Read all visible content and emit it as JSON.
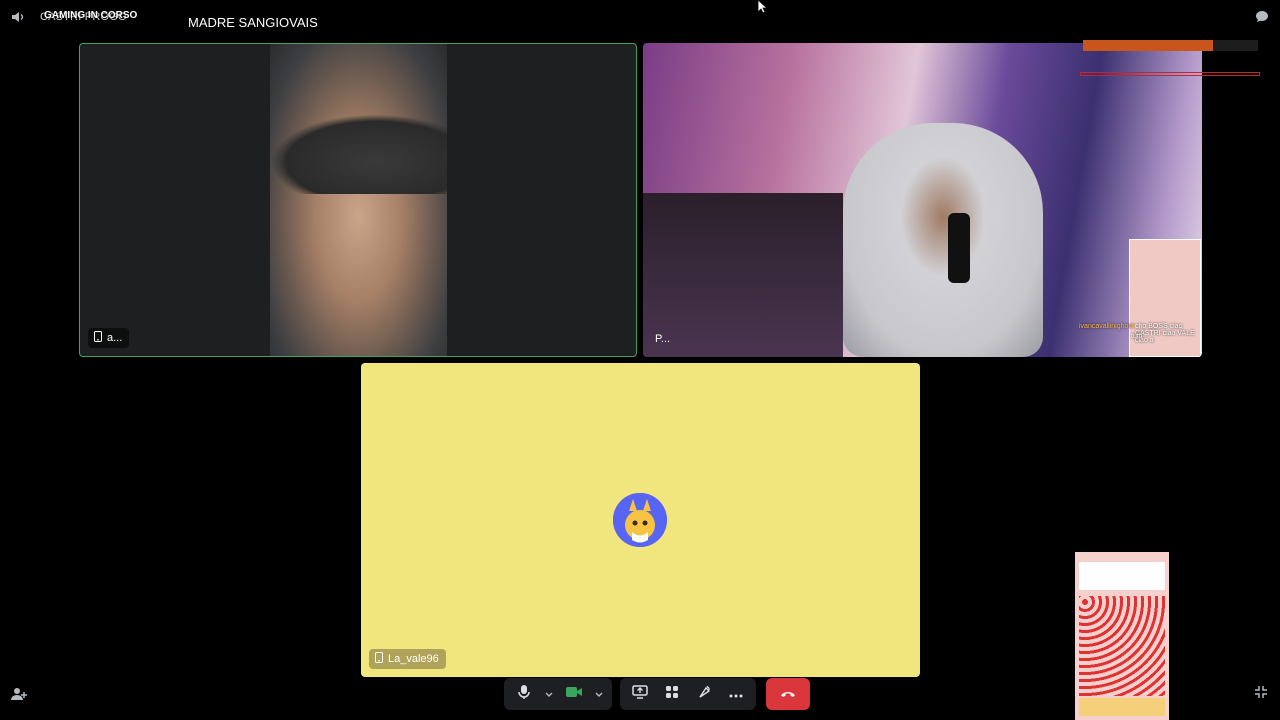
{
  "overlay": {
    "title_back": "CASTRI PROGO",
    "title_front": "GAMING IN CORSO",
    "subtitle": "MADRE SANGIOVAIS"
  },
  "tiles": [
    {
      "name": "a...",
      "device": "mobile"
    },
    {
      "name": "P...",
      "device": "desktop"
    },
    {
      "name": "La_vale96",
      "device": "mobile",
      "background": "#f1e57d"
    }
  ],
  "stream_overlay": {
    "chat_lines": [
      "ivancavallinighost",
      "cho BOSS ciao CASTRI ciao VALE ciao a",
      "tutti"
    ]
  },
  "controls": {
    "mic_icon": "microphone-icon",
    "camera_icon": "video-camera-icon",
    "screen_share_icon": "screen-share-icon",
    "activities_icon": "activities-icon",
    "soundboard_icon": "soundboard-icon",
    "more_icon": "more-options-icon",
    "hangup_icon": "phone-hangup-icon"
  },
  "colors": {
    "speaking_border": "#3ba55d",
    "hangup": "#da373c",
    "camera_active": "#3ba55d",
    "tile_yellow": "#f1e57d"
  }
}
